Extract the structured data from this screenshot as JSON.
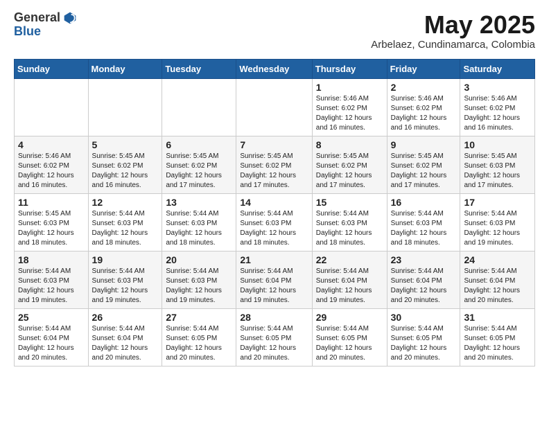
{
  "logo": {
    "general": "General",
    "blue": "Blue"
  },
  "header": {
    "month": "May 2025",
    "location": "Arbelaez, Cundinamarca, Colombia"
  },
  "weekdays": [
    "Sunday",
    "Monday",
    "Tuesday",
    "Wednesday",
    "Thursday",
    "Friday",
    "Saturday"
  ],
  "weeks": [
    [
      {
        "num": "",
        "info": ""
      },
      {
        "num": "",
        "info": ""
      },
      {
        "num": "",
        "info": ""
      },
      {
        "num": "",
        "info": ""
      },
      {
        "num": "1",
        "info": "Sunrise: 5:46 AM\nSunset: 6:02 PM\nDaylight: 12 hours\nand 16 minutes."
      },
      {
        "num": "2",
        "info": "Sunrise: 5:46 AM\nSunset: 6:02 PM\nDaylight: 12 hours\nand 16 minutes."
      },
      {
        "num": "3",
        "info": "Sunrise: 5:46 AM\nSunset: 6:02 PM\nDaylight: 12 hours\nand 16 minutes."
      }
    ],
    [
      {
        "num": "4",
        "info": "Sunrise: 5:46 AM\nSunset: 6:02 PM\nDaylight: 12 hours\nand 16 minutes."
      },
      {
        "num": "5",
        "info": "Sunrise: 5:45 AM\nSunset: 6:02 PM\nDaylight: 12 hours\nand 16 minutes."
      },
      {
        "num": "6",
        "info": "Sunrise: 5:45 AM\nSunset: 6:02 PM\nDaylight: 12 hours\nand 17 minutes."
      },
      {
        "num": "7",
        "info": "Sunrise: 5:45 AM\nSunset: 6:02 PM\nDaylight: 12 hours\nand 17 minutes."
      },
      {
        "num": "8",
        "info": "Sunrise: 5:45 AM\nSunset: 6:02 PM\nDaylight: 12 hours\nand 17 minutes."
      },
      {
        "num": "9",
        "info": "Sunrise: 5:45 AM\nSunset: 6:02 PM\nDaylight: 12 hours\nand 17 minutes."
      },
      {
        "num": "10",
        "info": "Sunrise: 5:45 AM\nSunset: 6:03 PM\nDaylight: 12 hours\nand 17 minutes."
      }
    ],
    [
      {
        "num": "11",
        "info": "Sunrise: 5:45 AM\nSunset: 6:03 PM\nDaylight: 12 hours\nand 18 minutes."
      },
      {
        "num": "12",
        "info": "Sunrise: 5:44 AM\nSunset: 6:03 PM\nDaylight: 12 hours\nand 18 minutes."
      },
      {
        "num": "13",
        "info": "Sunrise: 5:44 AM\nSunset: 6:03 PM\nDaylight: 12 hours\nand 18 minutes."
      },
      {
        "num": "14",
        "info": "Sunrise: 5:44 AM\nSunset: 6:03 PM\nDaylight: 12 hours\nand 18 minutes."
      },
      {
        "num": "15",
        "info": "Sunrise: 5:44 AM\nSunset: 6:03 PM\nDaylight: 12 hours\nand 18 minutes."
      },
      {
        "num": "16",
        "info": "Sunrise: 5:44 AM\nSunset: 6:03 PM\nDaylight: 12 hours\nand 18 minutes."
      },
      {
        "num": "17",
        "info": "Sunrise: 5:44 AM\nSunset: 6:03 PM\nDaylight: 12 hours\nand 19 minutes."
      }
    ],
    [
      {
        "num": "18",
        "info": "Sunrise: 5:44 AM\nSunset: 6:03 PM\nDaylight: 12 hours\nand 19 minutes."
      },
      {
        "num": "19",
        "info": "Sunrise: 5:44 AM\nSunset: 6:03 PM\nDaylight: 12 hours\nand 19 minutes."
      },
      {
        "num": "20",
        "info": "Sunrise: 5:44 AM\nSunset: 6:03 PM\nDaylight: 12 hours\nand 19 minutes."
      },
      {
        "num": "21",
        "info": "Sunrise: 5:44 AM\nSunset: 6:04 PM\nDaylight: 12 hours\nand 19 minutes."
      },
      {
        "num": "22",
        "info": "Sunrise: 5:44 AM\nSunset: 6:04 PM\nDaylight: 12 hours\nand 19 minutes."
      },
      {
        "num": "23",
        "info": "Sunrise: 5:44 AM\nSunset: 6:04 PM\nDaylight: 12 hours\nand 20 minutes."
      },
      {
        "num": "24",
        "info": "Sunrise: 5:44 AM\nSunset: 6:04 PM\nDaylight: 12 hours\nand 20 minutes."
      }
    ],
    [
      {
        "num": "25",
        "info": "Sunrise: 5:44 AM\nSunset: 6:04 PM\nDaylight: 12 hours\nand 20 minutes."
      },
      {
        "num": "26",
        "info": "Sunrise: 5:44 AM\nSunset: 6:04 PM\nDaylight: 12 hours\nand 20 minutes."
      },
      {
        "num": "27",
        "info": "Sunrise: 5:44 AM\nSunset: 6:05 PM\nDaylight: 12 hours\nand 20 minutes."
      },
      {
        "num": "28",
        "info": "Sunrise: 5:44 AM\nSunset: 6:05 PM\nDaylight: 12 hours\nand 20 minutes."
      },
      {
        "num": "29",
        "info": "Sunrise: 5:44 AM\nSunset: 6:05 PM\nDaylight: 12 hours\nand 20 minutes."
      },
      {
        "num": "30",
        "info": "Sunrise: 5:44 AM\nSunset: 6:05 PM\nDaylight: 12 hours\nand 20 minutes."
      },
      {
        "num": "31",
        "info": "Sunrise: 5:44 AM\nSunset: 6:05 PM\nDaylight: 12 hours\nand 20 minutes."
      }
    ]
  ]
}
